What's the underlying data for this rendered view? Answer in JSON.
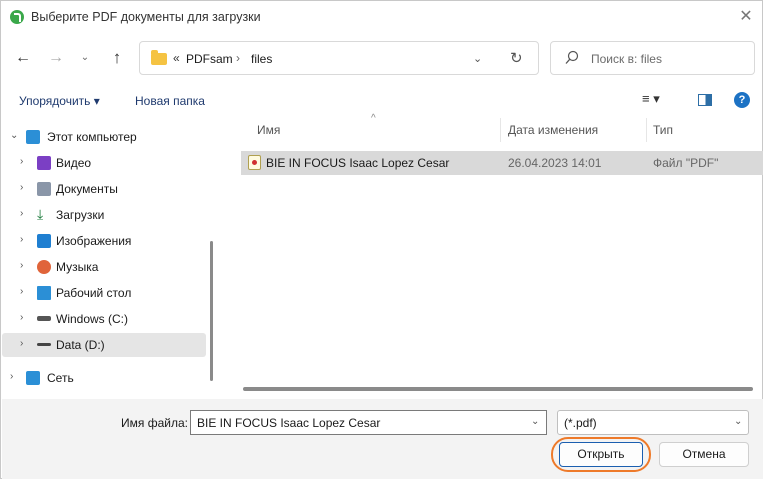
{
  "window": {
    "title": "Выберите PDF документы для загрузки",
    "close_glyph": "✕"
  },
  "nav_buttons": {
    "back": "←",
    "forward": "→",
    "recent": "⌄",
    "up": "↑"
  },
  "address": {
    "overflow": "«",
    "crumbs": [
      "PDFsam",
      "files"
    ],
    "separator": "›",
    "dropdown_glyph": "⌄",
    "refresh_glyph": "↻"
  },
  "search": {
    "placeholder": "Поиск в: files"
  },
  "toolbar": {
    "organize_label": "Упорядочить ▾",
    "new_folder_label": "Новая папка",
    "view_label": "≡ ▾",
    "help_label": "?"
  },
  "nav_tree": {
    "root": {
      "label": "Этот компьютер",
      "chevron": "⌄"
    },
    "items": [
      {
        "label": "Видео",
        "icon": "video-icon",
        "color": "#7b3fc4"
      },
      {
        "label": "Документы",
        "icon": "documents-icon",
        "color": "#8a96a8"
      },
      {
        "label": "Загрузки",
        "icon": "downloads-icon",
        "color": "#1a7a3a"
      },
      {
        "label": "Изображения",
        "icon": "pictures-icon",
        "color": "#1f7fd1"
      },
      {
        "label": "Музыка",
        "icon": "music-icon",
        "color": "#e0643a"
      },
      {
        "label": "Рабочий стол",
        "icon": "desktop-icon",
        "color": "#2b8fd6"
      },
      {
        "label": "Windows (C:)",
        "icon": "windows-drive-icon",
        "color": "#555555"
      },
      {
        "label": "Data (D:)",
        "icon": "data-drive-icon",
        "color": "#555555",
        "selected": true
      }
    ],
    "network": {
      "label": "Сеть",
      "icon": "network-icon",
      "color": "#2b8fd6"
    },
    "item_chevron": "›"
  },
  "columns": {
    "name": "Имя",
    "date": "Дата изменения",
    "type": "Тип",
    "sort_glyph": "^"
  },
  "files": [
    {
      "name": "BIE IN FOCUS Isaac Lopez Cesar",
      "date": "26.04.2023 14:01",
      "type": "Файл \"PDF\"",
      "selected": true
    }
  ],
  "bottom": {
    "filename_label": "Имя файла:",
    "filename_value": "BIE IN FOCUS Isaac Lopez Cesar",
    "filter_value": "(*.pdf)",
    "dropdown_glyph": "⌄",
    "open_label": "Открыть",
    "cancel_label": "Отмена",
    "highlight_color": "#ee7a2a"
  }
}
